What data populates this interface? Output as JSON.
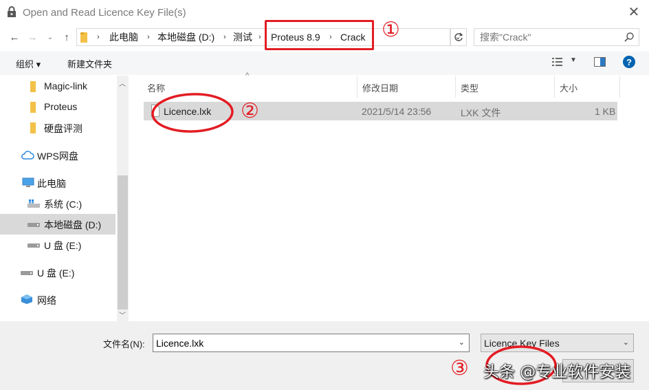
{
  "window": {
    "title": "Open and Read Licence Key File(s)",
    "close": "✕"
  },
  "address": {
    "crumbs": [
      "此电脑",
      "本地磁盘 (D:)",
      "测试",
      "Proteus 8.9",
      "Crack"
    ],
    "search_placeholder": "搜索\"Crack\""
  },
  "toolbar": {
    "organize": "组织 ▾",
    "new_folder": "新建文件夹"
  },
  "nav": {
    "items": [
      {
        "label": "Magic-link"
      },
      {
        "label": "Proteus"
      },
      {
        "label": "硬盘评测"
      },
      {
        "label": "WPS网盘"
      },
      {
        "label": "此电脑"
      },
      {
        "label": "系统 (C:)"
      },
      {
        "label": "本地磁盘 (D:)"
      },
      {
        "label": "U 盘 (E:)"
      },
      {
        "label": "U 盘 (E:)"
      },
      {
        "label": "网络"
      }
    ]
  },
  "columns": {
    "name": "名称",
    "date": "修改日期",
    "type": "类型",
    "size": "大小"
  },
  "files": [
    {
      "name": "Licence.lxk",
      "date": "2021/5/14 23:56",
      "type": "LXK 文件",
      "size": "1 KB"
    }
  ],
  "bottom": {
    "filename_label": "文件名(N):",
    "filename_value": "Licence.lxk",
    "filetype": "Licence Key Files",
    "watermark": "头条 @专业软件安装"
  },
  "annotations": {
    "n1": "①",
    "n2": "②",
    "n3": "③"
  },
  "colors": {
    "annotation_red": "#e31c23",
    "selection_blue": "#cce8ff",
    "help_blue": "#0063b1"
  }
}
